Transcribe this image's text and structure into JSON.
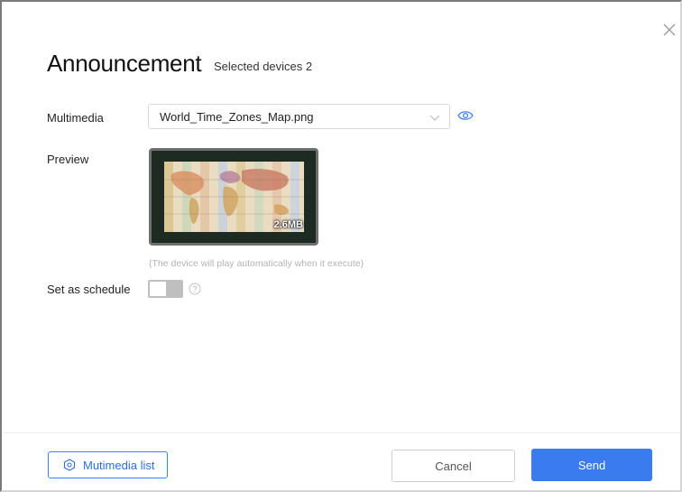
{
  "dialog": {
    "title": "Announcement",
    "subtitle": "Selected devices 2",
    "close_icon": "close-icon"
  },
  "form": {
    "multimedia_label": "Multimedia",
    "multimedia_value": "World_Time_Zones_Map.png",
    "preview_label": "Preview",
    "preview_size": "2.6MB",
    "hint": "(The device will play automatically when it execute)",
    "schedule_label": "Set as schedule",
    "schedule_enabled": false
  },
  "footer": {
    "media_list_label": "Mutimedia list",
    "cancel_label": "Cancel",
    "send_label": "Send"
  },
  "colors": {
    "accent": "#3b7bf0",
    "border": "#d9d9d9",
    "toggle_off": "#bfbfbf"
  }
}
